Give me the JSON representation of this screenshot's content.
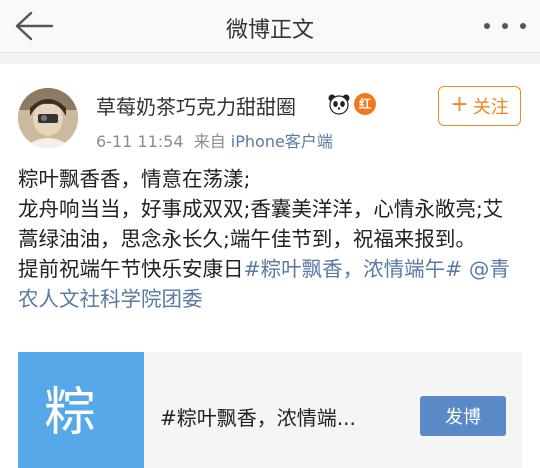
{
  "nav": {
    "title": "微博正文"
  },
  "post": {
    "author": "草莓奶茶巧克力甜甜圈",
    "badge": "红",
    "follow_label": "关注",
    "follow_plus": "+",
    "time": "6-11 11:54",
    "source_prefix": "来自",
    "source": "iPhone客户端",
    "lines": [
      "粽叶飘香香，情意在荡漾;",
      "龙舟响当当，好事成双双;香囊美洋洋，心情永敞亮;艾蒿绿油油，思念永长久;端午佳节到，祝福来报到。"
    ],
    "wish_text": "提前祝端午节快乐安康日",
    "hashtag": "#粽叶飘香，浓情端午#",
    "mention": "@青农人文社科学院团委"
  },
  "card": {
    "thumb_glyph": "粽",
    "title": "#粽叶飘香，浓情端...",
    "button": "发博"
  },
  "colors": {
    "accent_orange": "#f18725",
    "link_blue": "#5b79a6",
    "card_blue": "#57a8e8",
    "button_blue": "#5a89c8"
  }
}
